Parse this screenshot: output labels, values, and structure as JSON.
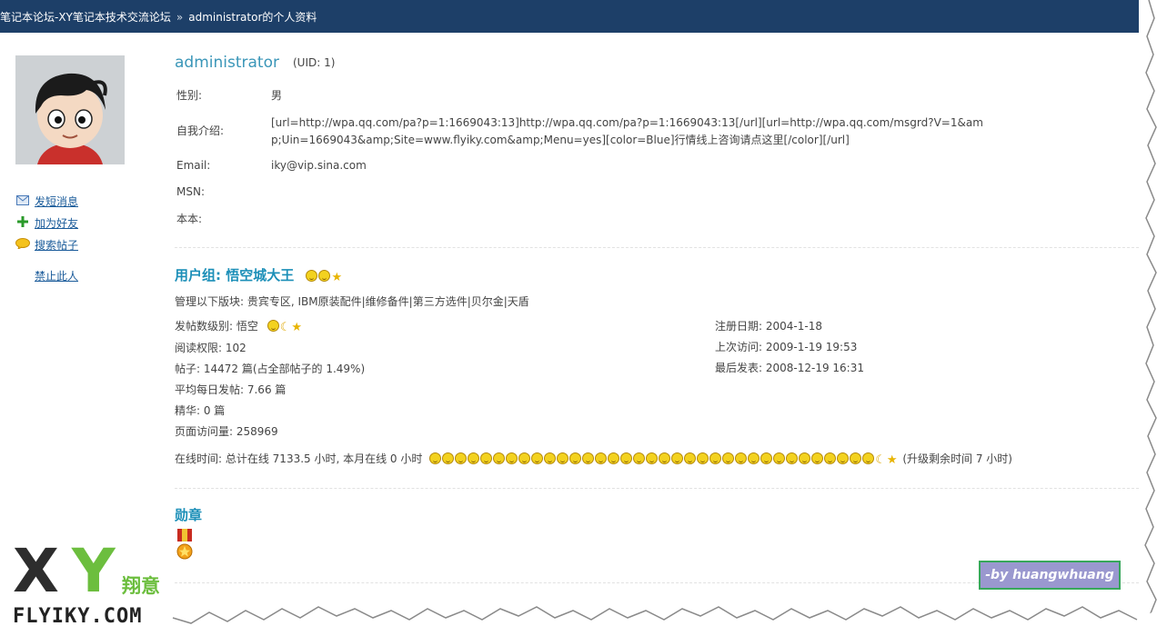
{
  "breadcrumb": {
    "forum": "笔记本论坛-XY笔记本技术交流论坛",
    "separator": "»",
    "page": "administrator的个人资料"
  },
  "sidebar": {
    "actions": [
      {
        "label": "发短消息",
        "icon": "envelope-icon"
      },
      {
        "label": "加为好友",
        "icon": "plus-icon"
      },
      {
        "label": "搜索帖子",
        "icon": "speech-bubble-icon"
      },
      {
        "label": "禁止此人",
        "icon": ""
      }
    ]
  },
  "profile": {
    "username": "administrator",
    "uid": "(UID: 1)",
    "fields": [
      {
        "label": "性别:",
        "value": "男"
      },
      {
        "label": "自我介绍:",
        "value": "[url=http://wpa.qq.com/pa?p=1:1669043:13]http://wpa.qq.com/pa?p=1:1669043:13[/url][url=http://wpa.qq.com/msgrd?V=1&amp;Uin=1669043&amp;Site=www.flyiky.com&amp;Menu=yes][color=Blue]行情线上咨询请点这里[/color][/url]"
      },
      {
        "label": "Email:",
        "value": "iky@vip.sina.com"
      },
      {
        "label": "MSN:",
        "value": ""
      },
      {
        "label": "本本:",
        "value": ""
      }
    ]
  },
  "group": {
    "title": "用户组: 悟空城大王",
    "manages": "管理以下版块: 贵宾专区, IBM原装配件|维修备件|第三方选件|贝尔金|天盾",
    "post_level": "发帖数级别: 悟空",
    "read_perm": "阅读权限: 102",
    "posts": "帖子: 14472 篇(占全部帖子的 1.49%)",
    "avg_posts": "平均每日发帖: 7.66 篇",
    "digest": "精华: 0 篇",
    "page_views": "页面访问量: 258969",
    "reg_date": "注册日期: 2004-1-18",
    "last_visit": "上次访问: 2009-1-19 19:53",
    "last_post": "最后发表: 2008-12-19 16:31",
    "online": "在线时间: 总计在线  7133.5 小时, 本月在线  0 小时",
    "online_suns": 35,
    "upgrade": "(升级剩余时间  7 小时)"
  },
  "medals": {
    "title": "勋章"
  },
  "signature": "-by huangwhuang",
  "logo": {
    "letters": "XY",
    "chinese": "翔意",
    "domain": "FLYIKY.COM"
  },
  "colors": {
    "topbar": "#1d3f68",
    "section_title": "#1c8fb8",
    "username": "#3a96b8",
    "logo_green": "#6cbe3e"
  }
}
